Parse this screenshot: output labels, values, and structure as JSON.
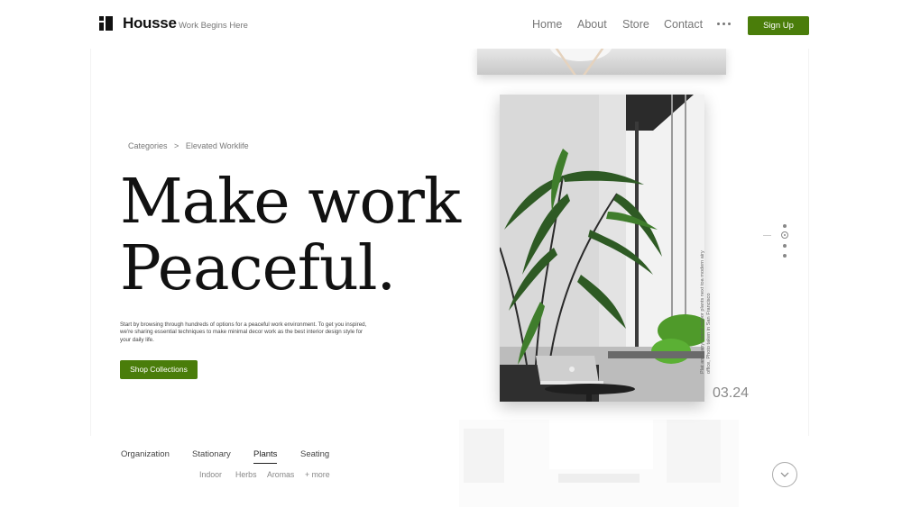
{
  "header": {
    "brand": "Housse",
    "tagline": "Work Begins Here",
    "nav": [
      "Home",
      "About",
      "Store",
      "Contact"
    ],
    "more_icon": "more-horizontal-icon",
    "signup_label": "Sign Up"
  },
  "hero": {
    "breadcrumb": [
      "Categories",
      ">",
      "Elevated Worklife"
    ],
    "title_line1": "Make work",
    "title_line2": "Peaceful.",
    "description": "Start by browsing through hundreds of options for a peaceful work environment. To get you inspired, we're sharing essential techniques to make minimal decor work as the best interior design style for your daily life.",
    "cta_label": "Shop Collections"
  },
  "feature": {
    "caption": "Plat and Lanyi stand indoor plants next toa modern airy office, Photo taken in San Francisco",
    "number": "03.24"
  },
  "slider": {
    "count": 4,
    "active_index": 1
  },
  "categories": {
    "tabs": [
      "Organization",
      "Stationary",
      "Plants",
      "Seating"
    ],
    "active_tab": "Plants",
    "subtabs": [
      "Indoor",
      "Herbs",
      "Aromas",
      "+ more"
    ]
  },
  "icons": {
    "logo": "housse-logo-icon",
    "scroll_down": "chevron-down-icon"
  },
  "colors": {
    "accent": "#4a7d0a",
    "text": "#111111",
    "muted": "#777777"
  }
}
